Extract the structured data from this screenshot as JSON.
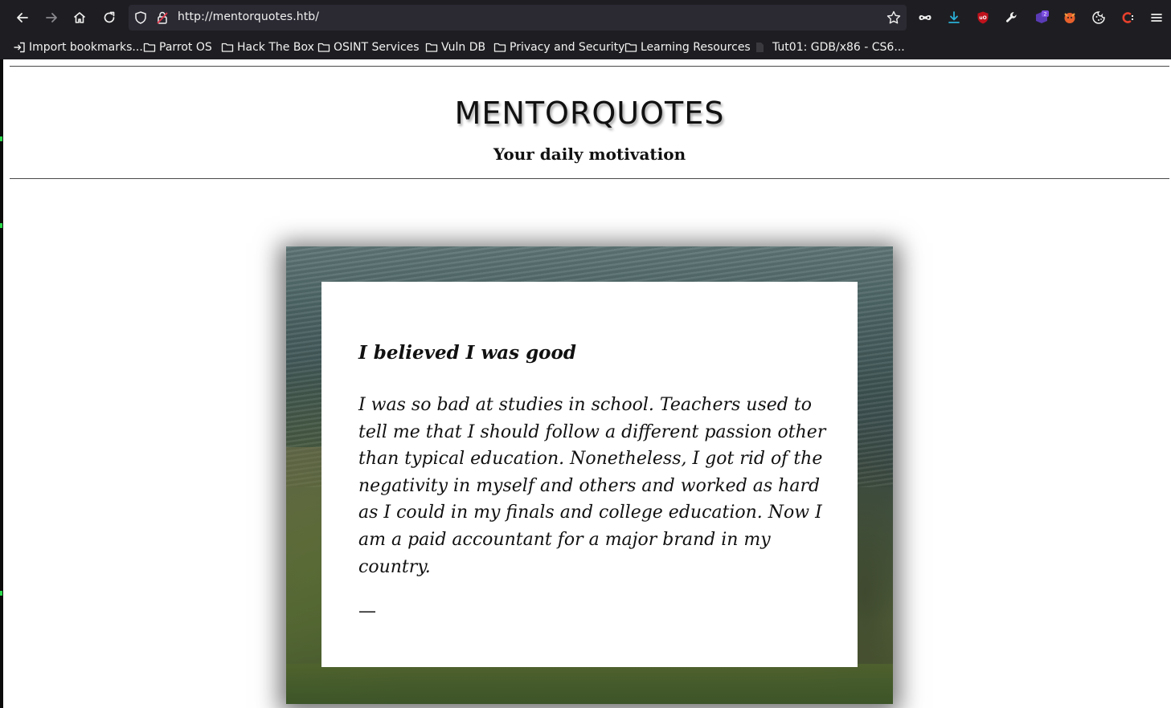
{
  "browser": {
    "url": "http://mentorquotes.htb/",
    "toolbar_icons": {
      "back": "back-arrow-icon",
      "forward": "forward-arrow-icon",
      "home": "home-icon",
      "reload": "reload-icon",
      "tracking": "shield-icon",
      "lock": "insecure-lock-icon",
      "bookmark": "star-icon",
      "extensions": [
        "mask-icon",
        "download-icon",
        "ublock-icon",
        "wrench-icon",
        "hackbar-icon",
        "foxyproxy-icon",
        "cookie-icon",
        "c-extension-icon",
        "hamburger-menu-icon"
      ],
      "extension_badge": "2"
    },
    "colors": {
      "chrome_bg": "#1e1e22",
      "urlbar_bg": "#2b2a33",
      "download_accent": "#2ab0d8",
      "ublock_red": "#c0121c"
    }
  },
  "bookmarks": [
    {
      "label": "Import bookmarks...",
      "icon": "import-icon"
    },
    {
      "label": "Parrot OS",
      "icon": "folder-icon"
    },
    {
      "label": "Hack The Box",
      "icon": "folder-icon"
    },
    {
      "label": "OSINT Services",
      "icon": "folder-icon"
    },
    {
      "label": "Vuln DB",
      "icon": "folder-icon"
    },
    {
      "label": "Privacy and Security",
      "icon": "folder-icon"
    },
    {
      "label": "Learning Resources",
      "icon": "folder-icon"
    },
    {
      "label": "Tut01: GDB/x86 - CS6...",
      "icon": "page-icon"
    }
  ],
  "site": {
    "title": "MENTORQUOTES",
    "subtitle": "Your daily motivation"
  },
  "quote": {
    "title": "I believed I was good",
    "text": "I was so bad at studies in school. Teachers used to tell me that I should follow a different passion other than typical education. Nonetheless, I got rid of the negativity in myself and others and worked as hard as I could in my finals and college education. Now I am a paid accountant for a major brand in my country.",
    "author": "—"
  }
}
